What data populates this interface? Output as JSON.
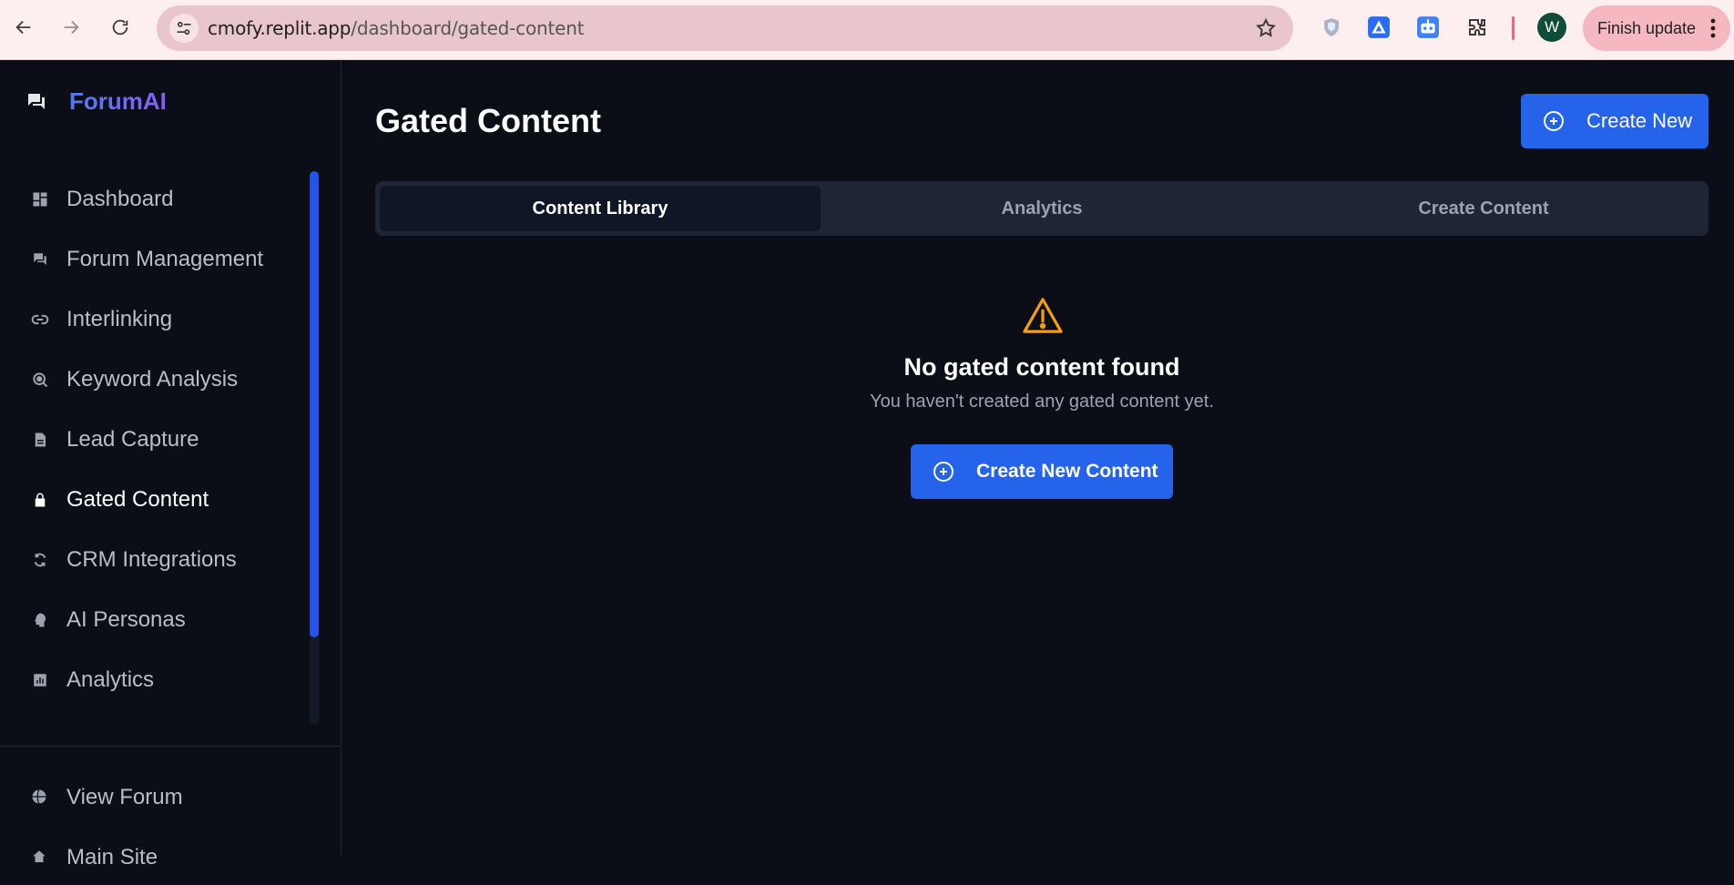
{
  "browser": {
    "url_host": "cmofy.replit.app",
    "url_path": "/dashboard/gated-content",
    "profile_initial": "W",
    "update_button": "Finish update"
  },
  "sidebar": {
    "brand": "ForumAI",
    "items": [
      {
        "label": "Dashboard",
        "icon": "dashboard-icon"
      },
      {
        "label": "Forum Management",
        "icon": "forum-icon"
      },
      {
        "label": "Interlinking",
        "icon": "link-icon"
      },
      {
        "label": "Keyword Analysis",
        "icon": "keyword-search-icon"
      },
      {
        "label": "Lead Capture",
        "icon": "document-icon"
      },
      {
        "label": "Gated Content",
        "icon": "lock-icon"
      },
      {
        "label": "CRM Integrations",
        "icon": "sync-icon"
      },
      {
        "label": "AI Personas",
        "icon": "persona-icon"
      },
      {
        "label": "Analytics",
        "icon": "analytics-icon"
      }
    ],
    "bottom": [
      {
        "label": "View Forum",
        "icon": "globe-icon"
      },
      {
        "label": "Main Site",
        "icon": "home-icon"
      }
    ]
  },
  "main": {
    "title": "Gated Content",
    "create_button": "Create New",
    "tabs": [
      "Content Library",
      "Analytics",
      "Create Content"
    ],
    "empty_state": {
      "title": "No gated content found",
      "subtitle": "You haven't created any gated content yet.",
      "button": "Create New Content"
    }
  },
  "colors": {
    "accent": "#2563eb",
    "background": "#0b0e17",
    "warning": "#f59e0b",
    "brand_gradient_start": "#4f7cf5",
    "brand_gradient_end": "#8b5cf6"
  }
}
